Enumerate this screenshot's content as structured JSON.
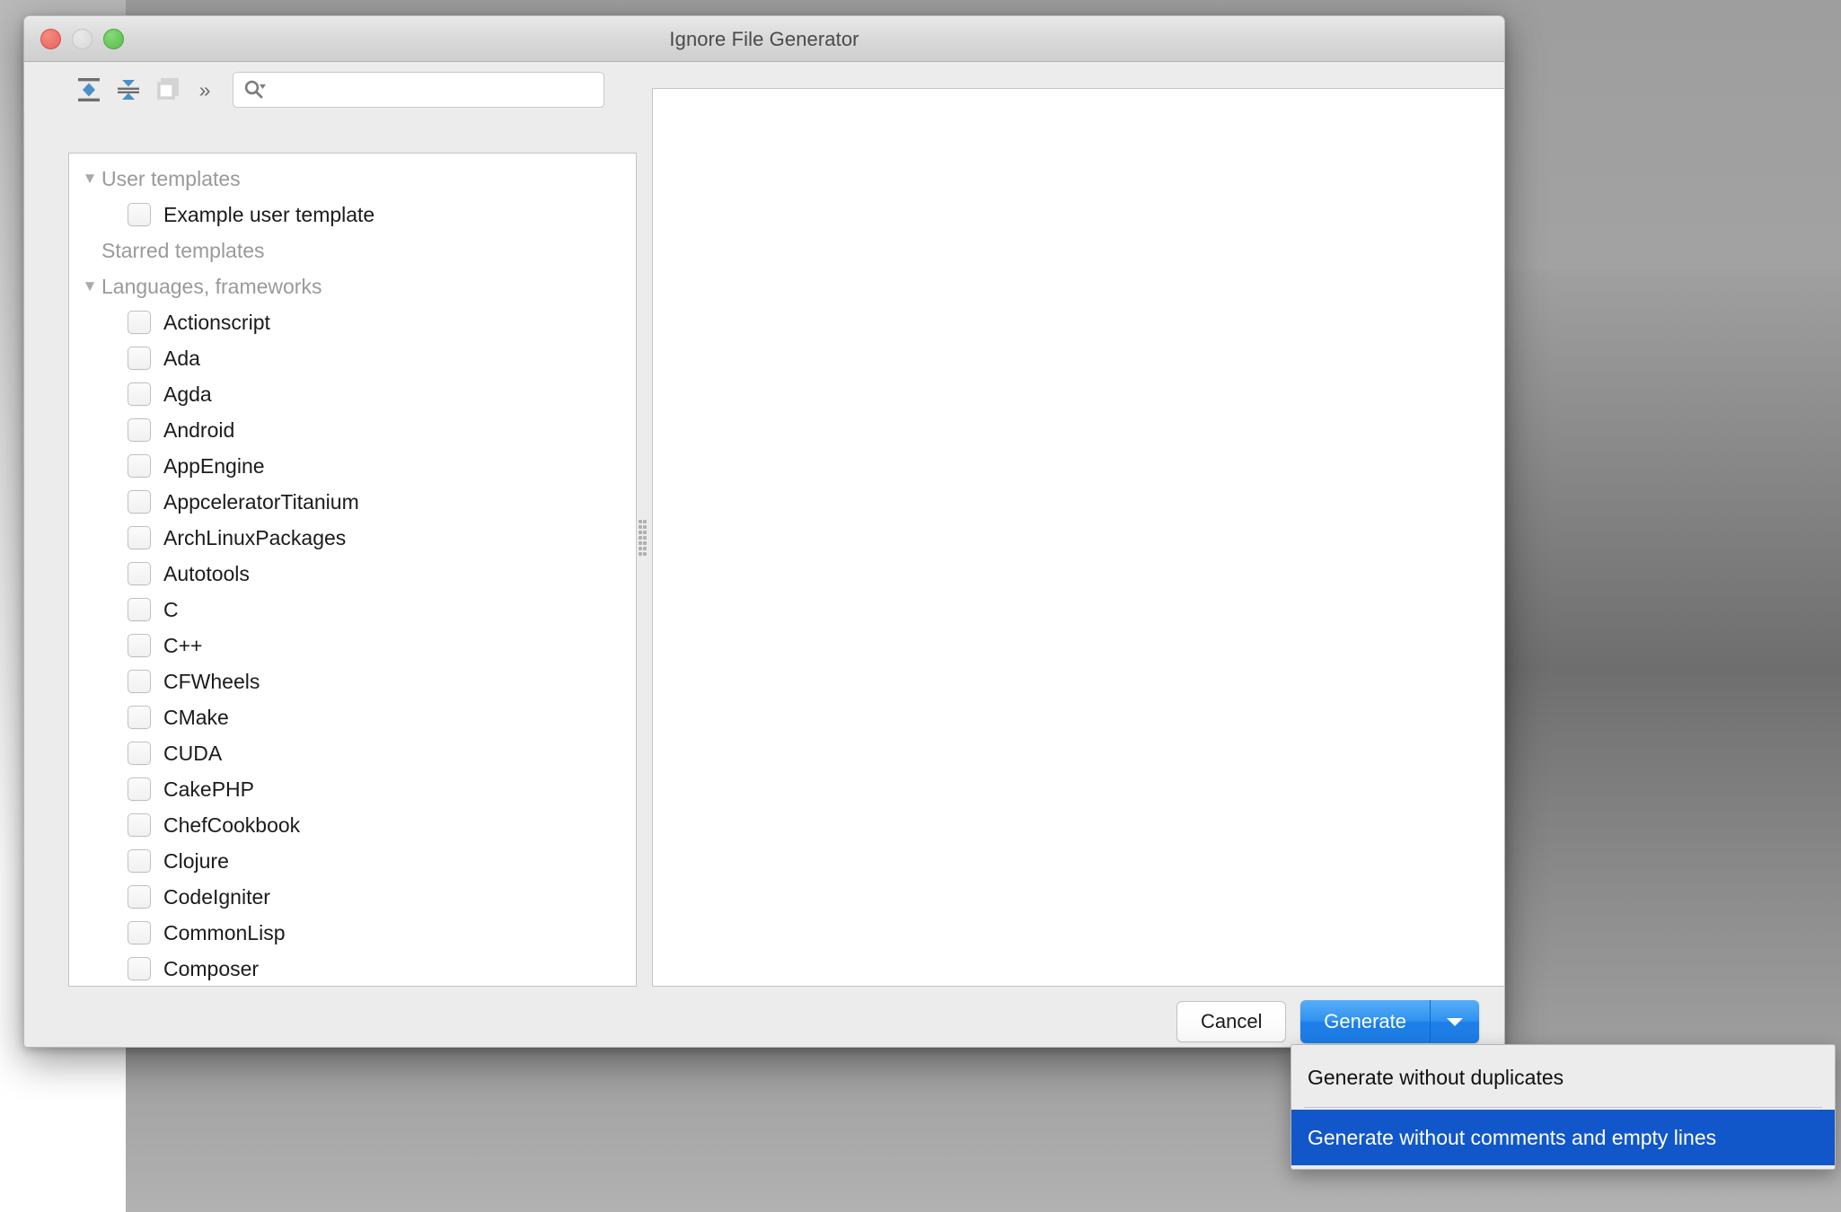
{
  "window": {
    "title": "Ignore File Generator",
    "traffic_lights": [
      "close-button",
      "minimize-button",
      "zoom-button"
    ]
  },
  "toolbar": {
    "buttons": [
      {
        "name": "expand-all-icon",
        "label": "Expand All"
      },
      {
        "name": "collapse-all-icon",
        "label": "Collapse All"
      },
      {
        "name": "copy-icon",
        "label": "Copy"
      }
    ],
    "overflow_label": "»",
    "search": {
      "value": "",
      "placeholder": "",
      "icon": "search-icon"
    }
  },
  "tree": {
    "rows": [
      {
        "type": "group",
        "label": "User templates",
        "expanded": true,
        "twisty": "▼"
      },
      {
        "type": "item",
        "label": "Example user template",
        "checked": false
      },
      {
        "type": "group",
        "label": "Starred templates",
        "expanded": false,
        "twisty": ""
      },
      {
        "type": "group",
        "label": "Languages, frameworks",
        "expanded": true,
        "twisty": "▼"
      },
      {
        "type": "item",
        "label": "Actionscript",
        "checked": false
      },
      {
        "type": "item",
        "label": "Ada",
        "checked": false
      },
      {
        "type": "item",
        "label": "Agda",
        "checked": false
      },
      {
        "type": "item",
        "label": "Android",
        "checked": false
      },
      {
        "type": "item",
        "label": "AppEngine",
        "checked": false
      },
      {
        "type": "item",
        "label": "AppceleratorTitanium",
        "checked": false
      },
      {
        "type": "item",
        "label": "ArchLinuxPackages",
        "checked": false
      },
      {
        "type": "item",
        "label": "Autotools",
        "checked": false
      },
      {
        "type": "item",
        "label": "C",
        "checked": false
      },
      {
        "type": "item",
        "label": "C++",
        "checked": false
      },
      {
        "type": "item",
        "label": "CFWheels",
        "checked": false
      },
      {
        "type": "item",
        "label": "CMake",
        "checked": false
      },
      {
        "type": "item",
        "label": "CUDA",
        "checked": false
      },
      {
        "type": "item",
        "label": "CakePHP",
        "checked": false
      },
      {
        "type": "item",
        "label": "ChefCookbook",
        "checked": false
      },
      {
        "type": "item",
        "label": "Clojure",
        "checked": false
      },
      {
        "type": "item",
        "label": "CodeIgniter",
        "checked": false
      },
      {
        "type": "item",
        "label": "CommonLisp",
        "checked": false
      },
      {
        "type": "item",
        "label": "Composer",
        "checked": false
      }
    ]
  },
  "preview": {
    "content": ""
  },
  "footer": {
    "cancel_label": "Cancel",
    "generate_label": "Generate",
    "generate_arrow": "▼"
  },
  "dropdown": {
    "items": [
      {
        "label": "Generate without duplicates",
        "selected": false
      },
      {
        "label": "Generate without comments and empty lines",
        "selected": true
      }
    ]
  },
  "colors": {
    "accent_blue": "#1d7ee8",
    "menu_selection_blue": "#1257c9",
    "window_bg": "#ececec",
    "panel_bg": "#ffffff",
    "group_text": "#9a9a9a",
    "item_text": "#1b1b1b"
  }
}
